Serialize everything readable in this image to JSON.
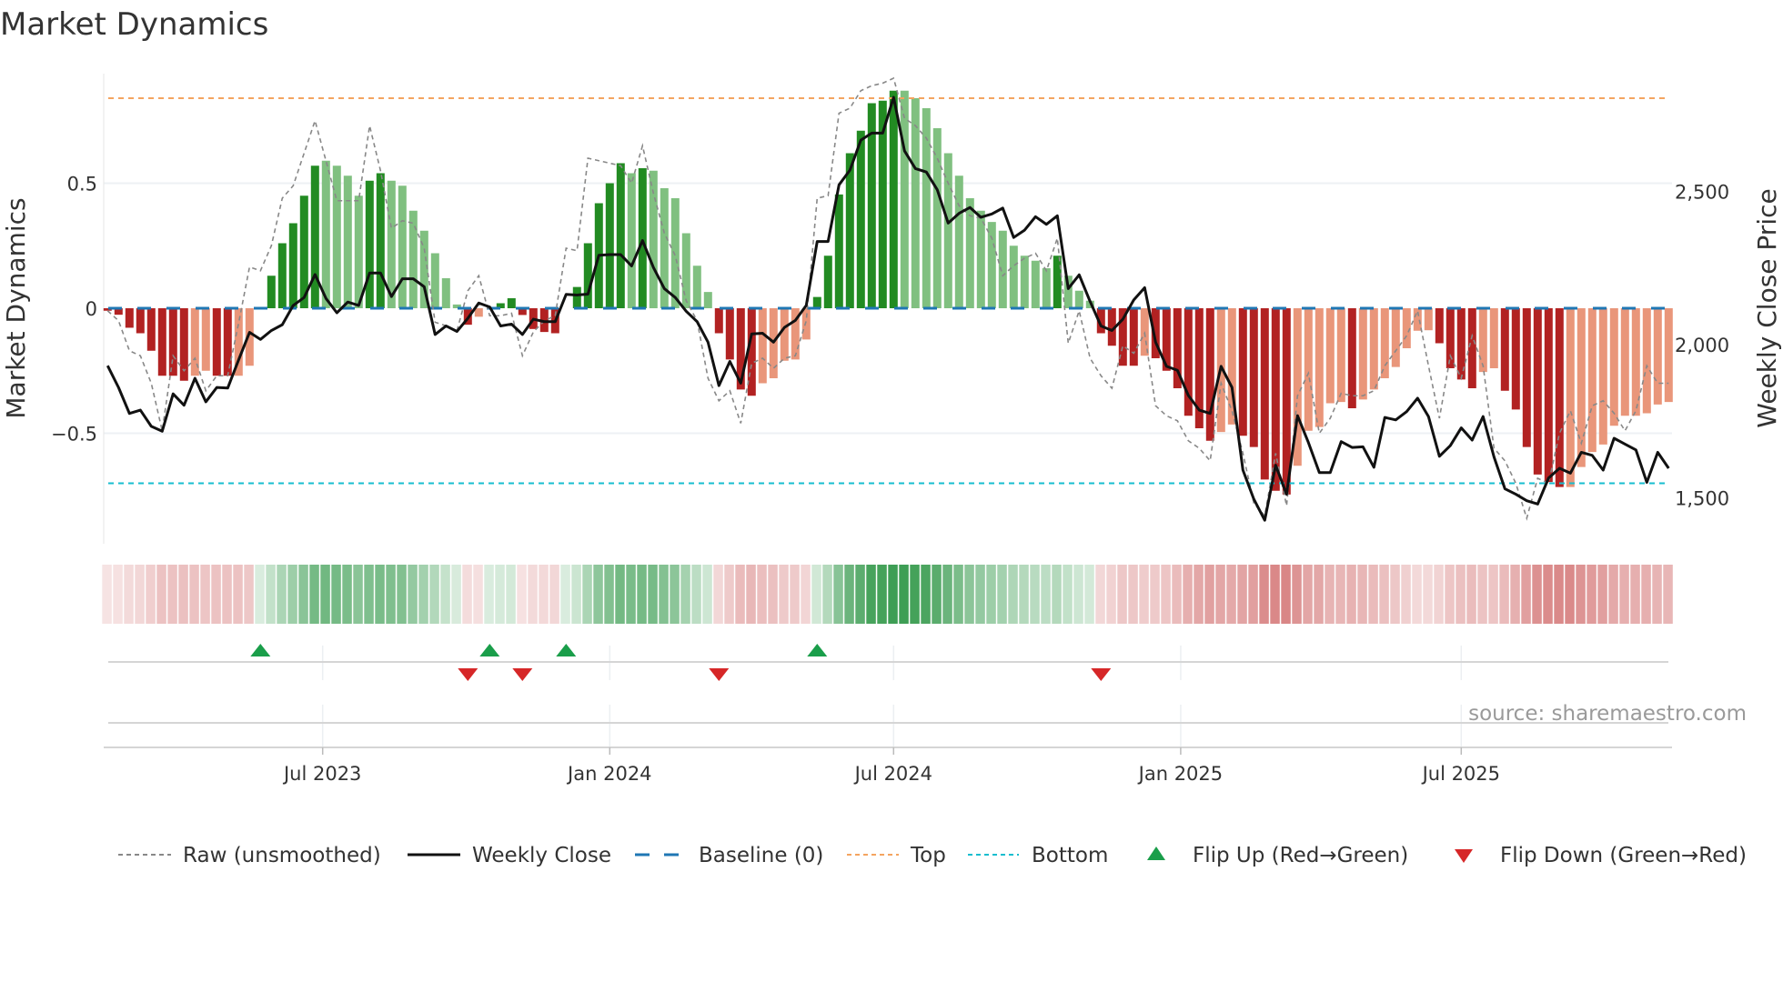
{
  "title": "Market Dynamics",
  "source": "source: sharemaestro.com",
  "chart_data": {
    "type": "bar",
    "title": "Market Dynamics",
    "ylabel": "Market Dynamics",
    "y2label": "Weekly Close Price",
    "ylim": [
      -0.88,
      1.0
    ],
    "y2lim": [
      1400,
      2900
    ],
    "x_unit": "week index",
    "top_level": 0.84,
    "bottom_level": -0.7,
    "baseline": 0,
    "yticks_left": [
      {
        "value": 0.5,
        "label": "0.5"
      },
      {
        "value": 0,
        "label": "0"
      },
      {
        "value": -0.5,
        "label": "−0.5"
      }
    ],
    "yticks_right": [
      {
        "value": 2500,
        "label": "2,500"
      },
      {
        "value": 2000,
        "label": "2,000"
      },
      {
        "value": 1500,
        "label": "1,500"
      }
    ],
    "xticks": [
      {
        "week": 19.7,
        "label": "Jul 2023"
      },
      {
        "week": 46.0,
        "label": "Jan 2024"
      },
      {
        "week": 72.0,
        "label": "Jul 2024"
      },
      {
        "week": 98.3,
        "label": "Jan 2025"
      },
      {
        "week": 124.0,
        "label": "Jul 2025"
      }
    ],
    "values": [
      -0.01,
      -0.026,
      -0.078,
      -0.1,
      -0.17,
      -0.27,
      -0.27,
      -0.29,
      -0.27,
      -0.25,
      -0.27,
      -0.27,
      -0.27,
      -0.23,
      0.0,
      0.13,
      0.26,
      0.34,
      0.45,
      0.57,
      0.59,
      0.57,
      0.53,
      0.45,
      0.51,
      0.54,
      0.51,
      0.49,
      0.39,
      0.31,
      0.22,
      0.12,
      0.015,
      -0.066,
      -0.034,
      0.0,
      0.02,
      0.04,
      -0.027,
      -0.083,
      -0.095,
      -0.1,
      0.0,
      0.085,
      0.26,
      0.42,
      0.5,
      0.58,
      0.54,
      0.56,
      0.55,
      0.48,
      0.44,
      0.3,
      0.17,
      0.065,
      -0.1,
      -0.205,
      -0.325,
      -0.35,
      -0.3,
      -0.28,
      -0.21,
      -0.205,
      -0.125,
      0.045,
      0.21,
      0.455,
      0.62,
      0.71,
      0.82,
      0.83,
      0.87,
      0.87,
      0.84,
      0.8,
      0.72,
      0.62,
      0.53,
      0.44,
      0.39,
      0.345,
      0.31,
      0.25,
      0.21,
      0.19,
      0.16,
      0.21,
      0.13,
      0.07,
      0.03,
      -0.1,
      -0.15,
      -0.23,
      -0.23,
      -0.19,
      -0.2,
      -0.25,
      -0.32,
      -0.43,
      -0.48,
      -0.53,
      -0.495,
      -0.465,
      -0.51,
      -0.555,
      -0.685,
      -0.73,
      -0.745,
      -0.63,
      -0.49,
      -0.475,
      -0.38,
      -0.375,
      -0.4,
      -0.365,
      -0.325,
      -0.28,
      -0.235,
      -0.16,
      -0.09,
      -0.088,
      -0.14,
      -0.24,
      -0.285,
      -0.32,
      -0.255,
      -0.24,
      -0.33,
      -0.405,
      -0.555,
      -0.665,
      -0.695,
      -0.715,
      -0.715,
      -0.635,
      -0.575,
      -0.545,
      -0.47,
      -0.43,
      -0.43,
      -0.42,
      -0.385,
      -0.375
    ],
    "strong": "111111110011000111110000110000000100111111011111010000001111000001111111100000000000000100011110111111001111100000100000001111001111110000000000",
    "raw": [
      -0.01,
      -0.05,
      -0.17,
      -0.19,
      -0.3,
      -0.49,
      -0.19,
      -0.25,
      -0.2,
      -0.33,
      -0.27,
      -0.27,
      -0.06,
      0.165,
      0.15,
      0.25,
      0.44,
      0.49,
      0.62,
      0.75,
      0.59,
      0.43,
      0.43,
      0.43,
      0.73,
      0.55,
      0.32,
      0.35,
      0.34,
      0.24,
      -0.056,
      -0.07,
      -0.09,
      0.07,
      0.13,
      -0.03,
      -0.03,
      -0.02,
      -0.19,
      -0.095,
      -0.05,
      -0.03,
      0.24,
      0.23,
      0.6,
      0.59,
      0.58,
      0.57,
      0.5,
      0.65,
      0.46,
      0.3,
      0.21,
      0.03,
      -0.05,
      -0.28,
      -0.37,
      -0.33,
      -0.46,
      -0.22,
      -0.2,
      -0.24,
      -0.2,
      -0.19,
      -0.05,
      0.44,
      0.45,
      0.78,
      0.8,
      0.87,
      0.89,
      0.9,
      0.92,
      0.76,
      0.73,
      0.68,
      0.6,
      0.5,
      0.41,
      0.37,
      0.36,
      0.28,
      0.13,
      0.17,
      0.2,
      0.22,
      0.15,
      0.28,
      -0.14,
      -0.01,
      -0.2,
      -0.27,
      -0.32,
      -0.15,
      -0.18,
      -0.1,
      -0.39,
      -0.43,
      -0.45,
      -0.53,
      -0.56,
      -0.61,
      -0.3,
      -0.41,
      -0.58,
      -0.78,
      -0.83,
      -0.58,
      -0.79,
      -0.35,
      -0.26,
      -0.5,
      -0.44,
      -0.34,
      -0.35,
      -0.35,
      -0.33,
      -0.23,
      -0.17,
      -0.11,
      -0.01,
      -0.23,
      -0.44,
      -0.19,
      -0.28,
      -0.11,
      -0.23,
      -0.56,
      -0.61,
      -0.7,
      -0.84,
      -0.68,
      -0.7,
      -0.5,
      -0.41,
      -0.54,
      -0.39,
      -0.37,
      -0.42,
      -0.49,
      -0.41,
      -0.23,
      -0.3,
      -0.3
    ],
    "close": [
      1931,
      1860,
      1775,
      1786,
      1733,
      1717,
      1839,
      1802,
      1890,
      1813,
      1860,
      1858,
      1950,
      2040,
      2017,
      2046,
      2065,
      2128,
      2154,
      2229,
      2151,
      2104,
      2139,
      2128,
      2234,
      2234,
      2157,
      2215,
      2215,
      2189,
      2033,
      2061,
      2043,
      2086,
      2136,
      2123,
      2061,
      2067,
      2033,
      2083,
      2075,
      2075,
      2164,
      2162,
      2165,
      2292,
      2294,
      2294,
      2257,
      2340,
      2252,
      2183,
      2154,
      2109,
      2075,
      2008,
      1866,
      1945,
      1874,
      2035,
      2037,
      2008,
      2056,
      2079,
      2128,
      2337,
      2337,
      2522,
      2570,
      2668,
      2691,
      2691,
      2808,
      2633,
      2575,
      2564,
      2506,
      2397,
      2429,
      2448,
      2416,
      2427,
      2446,
      2350,
      2374,
      2418,
      2393,
      2421,
      2183,
      2228,
      2141,
      2061,
      2046,
      2083,
      2146,
      2186,
      2008,
      1929,
      1916,
      1834,
      1786,
      1775,
      1929,
      1860,
      1590,
      1495,
      1426,
      1606,
      1511,
      1768,
      1680,
      1582,
      1582,
      1683,
      1664,
      1666,
      1599,
      1762,
      1754,
      1781,
      1825,
      1765,
      1635,
      1670,
      1728,
      1688,
      1765,
      1633,
      1529,
      1511,
      1490,
      1479,
      1564,
      1596,
      1580,
      1648,
      1638,
      1590,
      1694,
      1675,
      1656,
      1550,
      1648,
      1596
    ],
    "flip_up": [
      14,
      35,
      42,
      65
    ],
    "flip_down": [
      33,
      38,
      56,
      91
    ],
    "legend": {
      "placement": "bottom",
      "raw": "Raw (unsmoothed)",
      "close": "Weekly Close",
      "baseline": "Baseline (0)",
      "top": "Top",
      "bottom": "Bottom",
      "flip_up": "Flip Up (Red→Green)",
      "flip_down": "Flip Down (Green→Red)"
    },
    "colors": {
      "pos_strong": "#228b22",
      "pos_weak": "#80c080",
      "neg_strong": "#b22222",
      "neg_weak": "#e9967a",
      "baseline": "#1f77b4",
      "top": "#f4a460",
      "bottom": "#17becf",
      "close": "#111111",
      "raw": "#888888",
      "flip_up": "#1a9e4a",
      "flip_down": "#d62728"
    }
  }
}
